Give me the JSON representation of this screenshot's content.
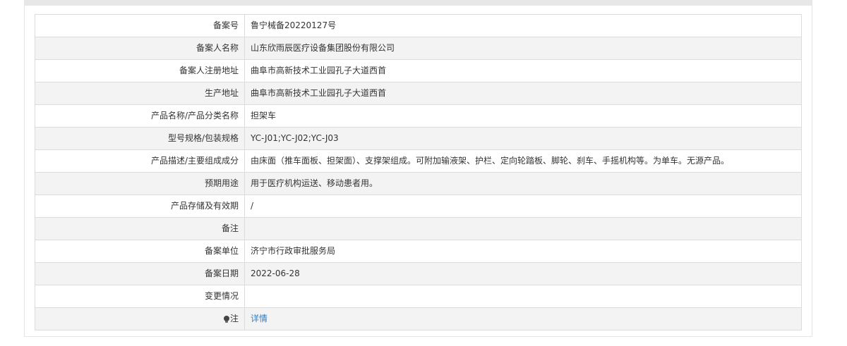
{
  "record": {
    "rows": [
      {
        "label": "备案号",
        "value": "鲁宁械备20220127号"
      },
      {
        "label": "备案人名称",
        "value": "山东欣雨辰医疗设备集团股份有限公司"
      },
      {
        "label": "备案人注册地址",
        "value": "曲阜市高新技术工业园孔子大道西首"
      },
      {
        "label": "生产地址",
        "value": "曲阜市高新技术工业园孔子大道西首"
      },
      {
        "label": "产品名称/产品分类名称",
        "value": "担架车"
      },
      {
        "label": "型号规格/包装规格",
        "value": "YC-J01;YC-J02;YC-J03"
      },
      {
        "label": "产品描述/主要组成成分",
        "value": "由床面（推车面板、担架面）、支撑架组成。可附加输液架、护栏、定向轮踏板、脚轮、刹车、手摇机构等。为单车。无源产品。"
      },
      {
        "label": "预期用途",
        "value": "用于医疗机构运送、移动患者用。"
      },
      {
        "label": "产品存储及有效期",
        "value": "/"
      },
      {
        "label": "备注",
        "value": ""
      },
      {
        "label": "备案单位",
        "value": "济宁市行政审批服务局"
      },
      {
        "label": "备案日期",
        "value": "2022-06-28"
      },
      {
        "label": "变更情况",
        "value": ""
      }
    ],
    "note": {
      "icon": "lightbulb-icon",
      "label": "注",
      "link_label": "详情"
    }
  },
  "colors": {
    "link": "#2f7fc6",
    "row_alt": "#f3f3f3",
    "border": "#dcdcdc"
  }
}
